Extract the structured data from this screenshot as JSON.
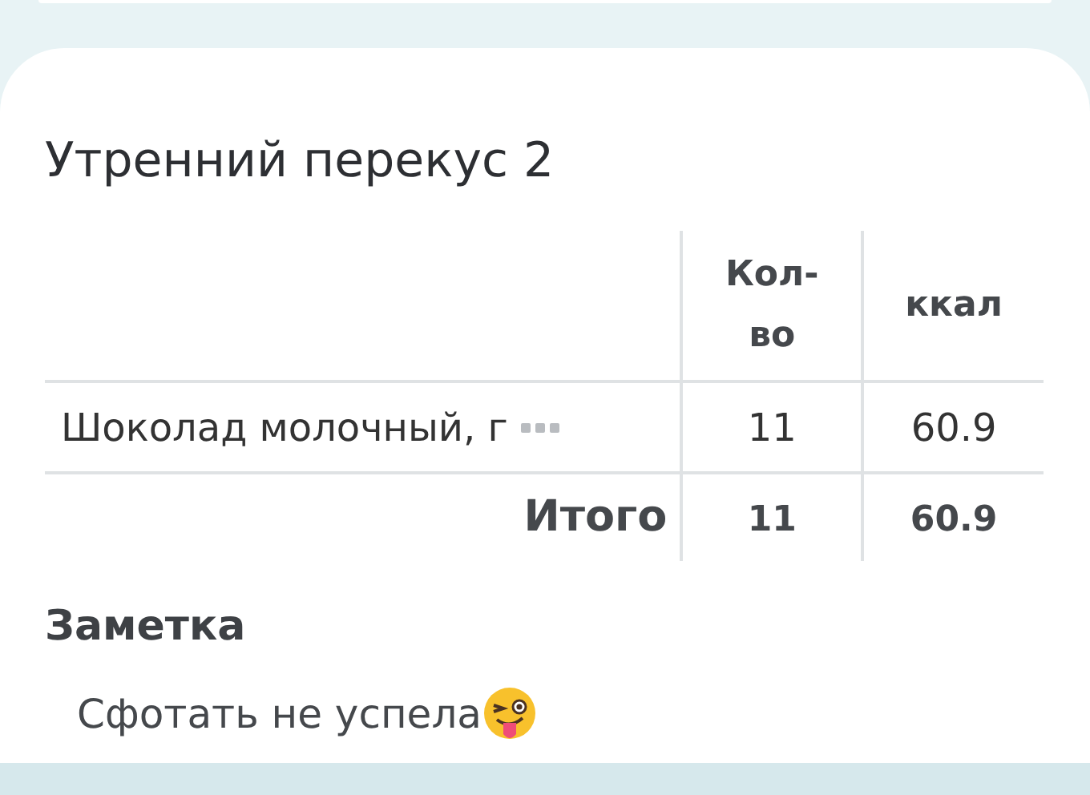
{
  "meal": {
    "title": "Утренний перекус 2"
  },
  "table": {
    "columns": [
      "Кол-во",
      "ккал"
    ],
    "rows": [
      {
        "name": "Шоколад молочный, г",
        "quantity": "11",
        "kcal": "60.9"
      }
    ],
    "total": {
      "label": "Итого",
      "quantity": "11",
      "kcal": "60.9"
    }
  },
  "note": {
    "heading": "Заметка",
    "text": "Сфотать не успела"
  }
}
